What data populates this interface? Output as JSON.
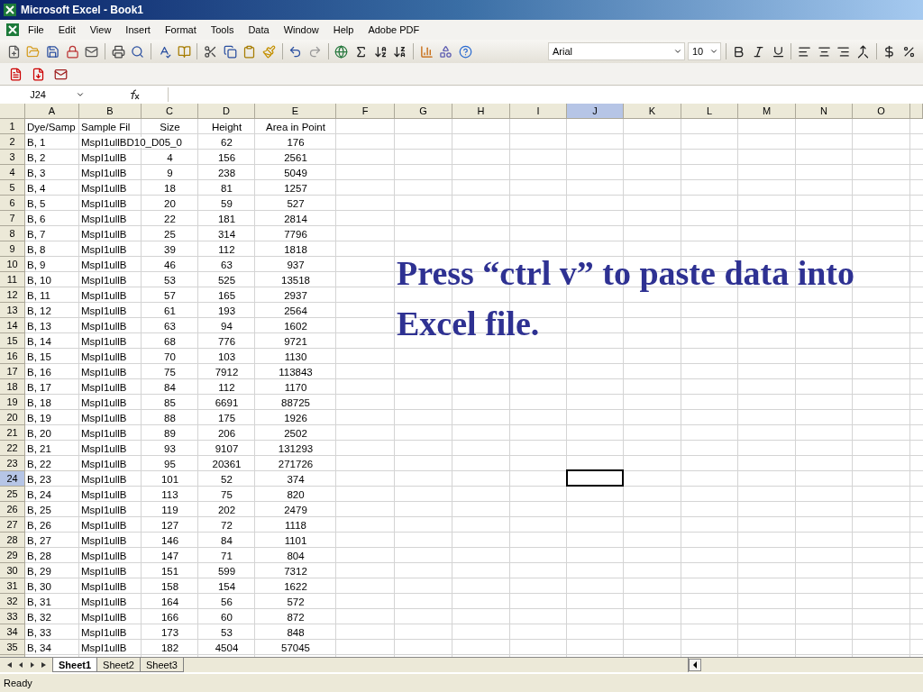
{
  "window": {
    "title": "Microsoft Excel - Book1"
  },
  "menu": [
    "File",
    "Edit",
    "View",
    "Insert",
    "Format",
    "Tools",
    "Data",
    "Window",
    "Help",
    "Adobe PDF"
  ],
  "formatting": {
    "font": "Arial",
    "size": "10"
  },
  "formula_bar": {
    "name_box": "J24"
  },
  "columns": [
    {
      "label": "A",
      "selected": false
    },
    {
      "label": "B",
      "selected": false
    },
    {
      "label": "C",
      "selected": false
    },
    {
      "label": "D",
      "selected": false
    },
    {
      "label": "E",
      "selected": false
    },
    {
      "label": "F",
      "selected": false
    },
    {
      "label": "G",
      "selected": false
    },
    {
      "label": "H",
      "selected": false
    },
    {
      "label": "I",
      "selected": false
    },
    {
      "label": "J",
      "selected": true
    },
    {
      "label": "K",
      "selected": false
    },
    {
      "label": "L",
      "selected": false
    },
    {
      "label": "M",
      "selected": false
    },
    {
      "label": "N",
      "selected": false
    },
    {
      "label": "O",
      "selected": false
    }
  ],
  "rows": [
    {
      "number": "1",
      "selected": false,
      "cells": {
        "A": "Dye/Samp",
        "B": "Sample Fil",
        "C": "Size",
        "D": "Height",
        "E": "Area in Point"
      }
    },
    {
      "number": "2",
      "selected": false,
      "cells": {
        "A": "B, 1",
        "B": "MspI1ullBD10_D05_0",
        "D": "62",
        "E": "176"
      }
    },
    {
      "number": "3",
      "selected": false,
      "cells": {
        "A": "B, 2",
        "B": "MspI1ullB",
        "C": "4",
        "D": "156",
        "E": "2561"
      }
    },
    {
      "number": "4",
      "selected": false,
      "cells": {
        "A": "B, 3",
        "B": "MspI1ullB",
        "C": "9",
        "D": "238",
        "E": "5049"
      }
    },
    {
      "number": "5",
      "selected": false,
      "cells": {
        "A": "B, 4",
        "B": "MspI1ullB",
        "C": "18",
        "D": "81",
        "E": "1257"
      }
    },
    {
      "number": "6",
      "selected": false,
      "cells": {
        "A": "B, 5",
        "B": "MspI1ullB",
        "C": "20",
        "D": "59",
        "E": "527"
      }
    },
    {
      "number": "7",
      "selected": false,
      "cells": {
        "A": "B, 6",
        "B": "MspI1ullB",
        "C": "22",
        "D": "181",
        "E": "2814"
      }
    },
    {
      "number": "8",
      "selected": false,
      "cells": {
        "A": "B, 7",
        "B": "MspI1ullB",
        "C": "25",
        "D": "314",
        "E": "7796"
      }
    },
    {
      "number": "9",
      "selected": false,
      "cells": {
        "A": "B, 8",
        "B": "MspI1ullB",
        "C": "39",
        "D": "112",
        "E": "1818"
      }
    },
    {
      "number": "10",
      "selected": false,
      "cells": {
        "A": "B, 9",
        "B": "MspI1ullB",
        "C": "46",
        "D": "63",
        "E": "937"
      }
    },
    {
      "number": "11",
      "selected": false,
      "cells": {
        "A": "B, 10",
        "B": "MspI1ullB",
        "C": "53",
        "D": "525",
        "E": "13518"
      }
    },
    {
      "number": "12",
      "selected": false,
      "cells": {
        "A": "B, 11",
        "B": "MspI1ullB",
        "C": "57",
        "D": "165",
        "E": "2937"
      }
    },
    {
      "number": "13",
      "selected": false,
      "cells": {
        "A": "B, 12",
        "B": "MspI1ullB",
        "C": "61",
        "D": "193",
        "E": "2564"
      }
    },
    {
      "number": "14",
      "selected": false,
      "cells": {
        "A": "B, 13",
        "B": "MspI1ullB",
        "C": "63",
        "D": "94",
        "E": "1602"
      }
    },
    {
      "number": "15",
      "selected": false,
      "cells": {
        "A": "B, 14",
        "B": "MspI1ullB",
        "C": "68",
        "D": "776",
        "E": "9721"
      }
    },
    {
      "number": "16",
      "selected": false,
      "cells": {
        "A": "B, 15",
        "B": "MspI1ullB",
        "C": "70",
        "D": "103",
        "E": "1130"
      }
    },
    {
      "number": "17",
      "selected": false,
      "cells": {
        "A": "B, 16",
        "B": "MspI1ullB",
        "C": "75",
        "D": "7912",
        "E": "113843"
      }
    },
    {
      "number": "18",
      "selected": false,
      "cells": {
        "A": "B, 17",
        "B": "MspI1ullB",
        "C": "84",
        "D": "112",
        "E": "1170"
      }
    },
    {
      "number": "19",
      "selected": false,
      "cells": {
        "A": "B, 18",
        "B": "MspI1ullB",
        "C": "85",
        "D": "6691",
        "E": "88725"
      }
    },
    {
      "number": "20",
      "selected": false,
      "cells": {
        "A": "B, 19",
        "B": "MspI1ullB",
        "C": "88",
        "D": "175",
        "E": "1926"
      }
    },
    {
      "number": "21",
      "selected": false,
      "cells": {
        "A": "B, 20",
        "B": "MspI1ullB",
        "C": "89",
        "D": "206",
        "E": "2502"
      }
    },
    {
      "number": "22",
      "selected": false,
      "cells": {
        "A": "B, 21",
        "B": "MspI1ullB",
        "C": "93",
        "D": "9107",
        "E": "131293"
      }
    },
    {
      "number": "23",
      "selected": false,
      "cells": {
        "A": "B, 22",
        "B": "MspI1ullB",
        "C": "95",
        "D": "20361",
        "E": "271726"
      }
    },
    {
      "number": "24",
      "selected": true,
      "cells": {
        "A": "B, 23",
        "B": "MspI1ullB",
        "C": "101",
        "D": "52",
        "E": "374"
      }
    },
    {
      "number": "25",
      "selected": false,
      "cells": {
        "A": "B, 24",
        "B": "MspI1ullB",
        "C": "113",
        "D": "75",
        "E": "820"
      }
    },
    {
      "number": "26",
      "selected": false,
      "cells": {
        "A": "B, 25",
        "B": "MspI1ullB",
        "C": "119",
        "D": "202",
        "E": "2479"
      }
    },
    {
      "number": "27",
      "selected": false,
      "cells": {
        "A": "B, 26",
        "B": "MspI1ullB",
        "C": "127",
        "D": "72",
        "E": "1118"
      }
    },
    {
      "number": "28",
      "selected": false,
      "cells": {
        "A": "B, 27",
        "B": "MspI1ullB",
        "C": "146",
        "D": "84",
        "E": "1101"
      }
    },
    {
      "number": "29",
      "selected": false,
      "cells": {
        "A": "B, 28",
        "B": "MspI1ullB",
        "C": "147",
        "D": "71",
        "E": "804"
      }
    },
    {
      "number": "30",
      "selected": false,
      "cells": {
        "A": "B, 29",
        "B": "MspI1ullB",
        "C": "151",
        "D": "599",
        "E": "7312"
      }
    },
    {
      "number": "31",
      "selected": false,
      "cells": {
        "A": "B, 30",
        "B": "MspI1ullB",
        "C": "158",
        "D": "154",
        "E": "1622"
      }
    },
    {
      "number": "32",
      "selected": false,
      "cells": {
        "A": "B, 31",
        "B": "MspI1ullB",
        "C": "164",
        "D": "56",
        "E": "572"
      }
    },
    {
      "number": "33",
      "selected": false,
      "cells": {
        "A": "B, 32",
        "B": "MspI1ullB",
        "C": "166",
        "D": "60",
        "E": "872"
      }
    },
    {
      "number": "34",
      "selected": false,
      "cells": {
        "A": "B, 33",
        "B": "MspI1ullB",
        "C": "173",
        "D": "53",
        "E": "848"
      }
    },
    {
      "number": "35",
      "selected": false,
      "cells": {
        "A": "B, 34",
        "B": "MspI1ullB",
        "C": "182",
        "D": "4504",
        "E": "57045"
      }
    }
  ],
  "overlay_text": "Press “ctrl v” to paste data into Excel file.",
  "sheet_tabs": [
    {
      "label": "Sheet1",
      "selected": true
    },
    {
      "label": "Sheet2",
      "selected": false
    },
    {
      "label": "Sheet3",
      "selected": false
    }
  ],
  "status_bar": "Ready"
}
